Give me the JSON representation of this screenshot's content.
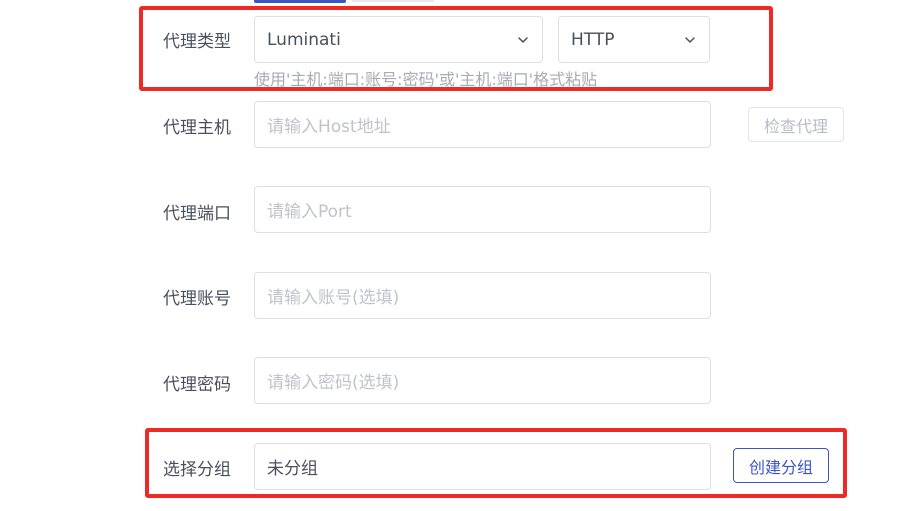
{
  "colors": {
    "accent": "#3b55c8",
    "highlight": "#ee2a24",
    "label": "#4a4f5c",
    "placeholder": "#bfc3cc",
    "border": "#dcdfe6"
  },
  "proxy_type": {
    "label": "代理类型",
    "provider_value": "Luminati",
    "protocol_value": "HTTP",
    "hint": "使用'主机:端口:账号:密码'或'主机:端口'格式粘贴",
    "chevron_icon": "chevron-down-icon"
  },
  "proxy_host": {
    "label": "代理主机",
    "placeholder": "请输入Host地址",
    "check_button": "检查代理"
  },
  "proxy_port": {
    "label": "代理端口",
    "placeholder": "请输入Port"
  },
  "proxy_account": {
    "label": "代理账号",
    "placeholder": "请输入账号(选填)"
  },
  "proxy_password": {
    "label": "代理密码",
    "placeholder": "请输入密码(选填)"
  },
  "group": {
    "label": "选择分组",
    "value": "未分组",
    "create_button": "创建分组"
  }
}
